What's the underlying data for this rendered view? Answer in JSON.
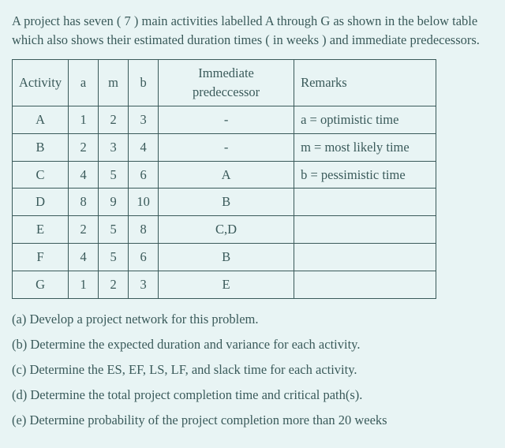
{
  "intro": "A project has seven ( 7 ) main activities labelled A through G as shown in the below table which also shows their estimated duration times ( in weeks ) and immediate predecessors.",
  "headers": {
    "activity": "Activity",
    "a": "a",
    "m": "m",
    "b": "b",
    "pred": "Immediate predeccessor",
    "remarks": "Remarks"
  },
  "rows": [
    {
      "activity": "A",
      "a": "1",
      "m": "2",
      "b": "3",
      "pred": "-",
      "remarks": "a = optimistic time"
    },
    {
      "activity": "B",
      "a": "2",
      "m": "3",
      "b": "4",
      "pred": "-",
      "remarks": "m = most likely time"
    },
    {
      "activity": "C",
      "a": "4",
      "m": "5",
      "b": "6",
      "pred": "A",
      "remarks": "b = pessimistic time"
    },
    {
      "activity": "D",
      "a": "8",
      "m": "9",
      "b": "10",
      "pred": "B",
      "remarks": ""
    },
    {
      "activity": "E",
      "a": "2",
      "m": "5",
      "b": "8",
      "pred": "C,D",
      "remarks": ""
    },
    {
      "activity": "F",
      "a": "4",
      "m": "5",
      "b": "6",
      "pred": "B",
      "remarks": ""
    },
    {
      "activity": "G",
      "a": "1",
      "m": "2",
      "b": "3",
      "pred": "E",
      "remarks": ""
    }
  ],
  "questions": {
    "qa": "(a) Develop a project network for this problem.",
    "qb": "(b) Determine the expected duration and variance for each activity.",
    "qc": "(c) Determine the ES, EF, LS, LF, and slack time for each activity.",
    "qd": "(d) Determine the total project completion time and critical path(s).",
    "qe": "(e) Determine probability of the project completion more than 20 weeks"
  }
}
